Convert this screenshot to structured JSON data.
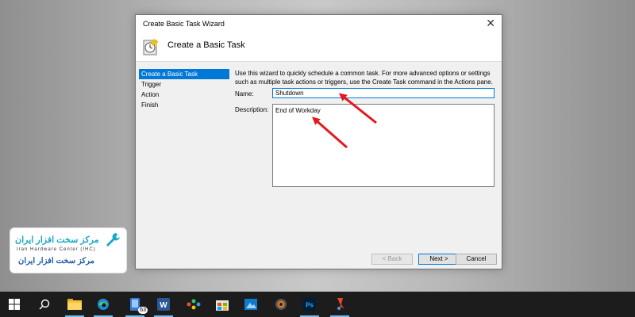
{
  "window": {
    "title": "Create Basic Task Wizard",
    "close_glyph": "✕",
    "header_title": "Create a Basic Task",
    "header_icon": "task-scheduler-icon"
  },
  "steps": [
    {
      "label": "Create a Basic Task",
      "active": true
    },
    {
      "label": "Trigger",
      "active": false
    },
    {
      "label": "Action",
      "active": false
    },
    {
      "label": "Finish",
      "active": false
    }
  ],
  "content": {
    "instructions": "Use this wizard to quickly schedule a common task.  For more advanced options or settings such as multiple task actions or triggers, use the Create Task command in the Actions pane.",
    "name_label": "Name:",
    "name_value": "Shutdown",
    "description_label": "Description:",
    "description_value": "End of Workday"
  },
  "buttons": {
    "back": "< Back",
    "next": "Next >",
    "cancel": "Cancel"
  },
  "logo": {
    "line1": "مرکز سخت افزار ایران",
    "line2": "Iran Hardware Center (IHC)",
    "line3": "مرکز سخت افزار ایران"
  },
  "taskbar": {
    "items": [
      "windows-start-icon",
      "search-icon",
      "file-explorer-icon",
      "edge-icon",
      "tablet-icon",
      "word-icon",
      "paint-icon",
      "store-icon",
      "photos-icon",
      "media-icon",
      "photoshop-icon",
      "snipping-icon"
    ],
    "badge": "63",
    "word_glyph": "W",
    "ps_glyph": "Ps"
  },
  "colors": {
    "accent": "#0078d7",
    "arrow": "#e3191f",
    "taskbar": "#1c1c1c"
  }
}
